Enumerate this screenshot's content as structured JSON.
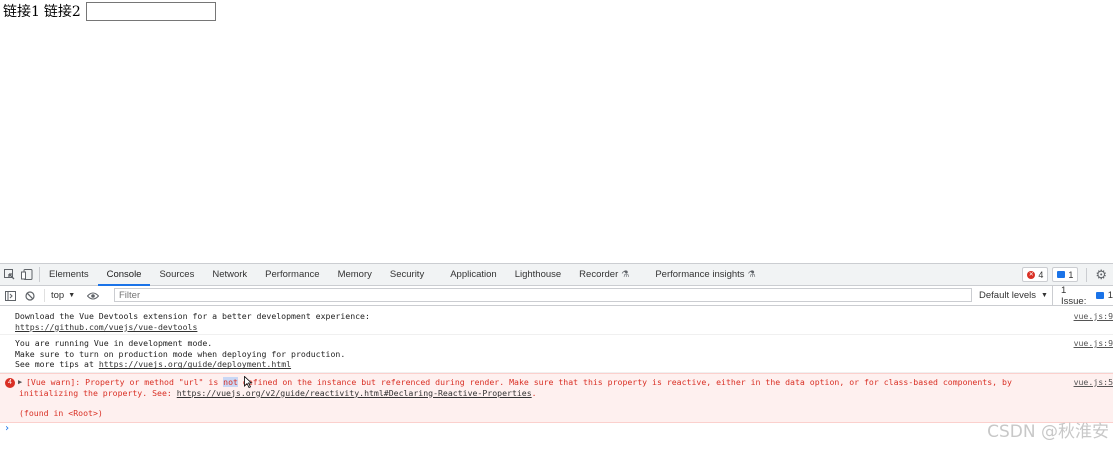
{
  "page": {
    "link1": "链接1",
    "link2": "链接2",
    "input_value": ""
  },
  "devtools": {
    "tabs": [
      {
        "label": "Elements"
      },
      {
        "label": "Console"
      },
      {
        "label": "Sources"
      },
      {
        "label": "Network"
      },
      {
        "label": "Performance"
      },
      {
        "label": "Memory"
      },
      {
        "label": "Security"
      },
      {
        "label": "Application"
      },
      {
        "label": "Lighthouse"
      },
      {
        "label": "Recorder"
      },
      {
        "label": "Performance insights"
      }
    ],
    "active_tab": "Console",
    "error_count": "4",
    "message_count": "1",
    "toolbar": {
      "context": "top",
      "filter_placeholder": "Filter",
      "levels": "Default levels",
      "issues_label": "1 Issue:",
      "issues_count": "1"
    },
    "messages": [
      {
        "line1": "Download the Vue Devtools extension for a better development experience:",
        "link": "https://github.com/vuejs/vue-devtools",
        "source": "vue.js:9"
      },
      {
        "line1": "You are running Vue in development mode.",
        "line2": "Make sure to turn on production mode when deploying for production.",
        "line3_prefix": "See more tips at",
        "link": "https://vuejs.org/guide/deployment.html",
        "source": "vue.js:9"
      }
    ],
    "error": {
      "count": "4",
      "text_a": "[Vue warn]: Property or method \"url\" is ",
      "text_hl": "not",
      "text_b": " defined on the instance but referenced during render. Make sure that this property is reactive, either in the data option, or for class-based components, by",
      "text_c": "initializing the property. See: ",
      "link": "https://vuejs.org/v2/guide/reactivity.html#Declaring-Reactive-Properties",
      "text_d": ".",
      "found": "(found in <Root>)",
      "source": "vue.js:5"
    },
    "prompt": "›"
  },
  "watermark": "CSDN @秋淮安",
  "colors": {
    "error": "#d93025",
    "error_bg": "#fef0ef",
    "accent": "#1a73e8"
  }
}
